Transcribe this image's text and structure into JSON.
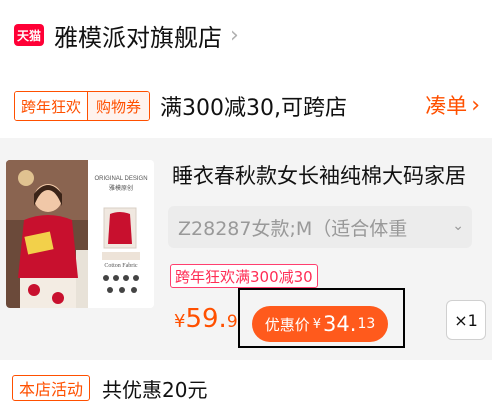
{
  "store": {
    "logo_text": "天猫",
    "name": "雅模派对旗舰店"
  },
  "promo": {
    "tag_left": "跨年狂欢",
    "tag_right": "购物券",
    "text": "满300减30,可跨店",
    "action_label": "凑单"
  },
  "item": {
    "title": "睡衣春秋款女长袖纯棉大码家居",
    "sku": "Z28287女款;M（适合体重",
    "event_tag": "跨年狂欢满300减30",
    "price_symbol": "¥",
    "price_integer": "59.",
    "price_decimal": "9",
    "discount_label": "优惠价",
    "discount_symbol": "¥",
    "discount_integer": "34.",
    "discount_decimal": "13",
    "quantity": "×1",
    "thumb_text_top": "ORIGINAL DESIGN",
    "thumb_text_sub": "雅模原创",
    "thumb_text_bottom": "Cotton Fabric"
  },
  "shop_activity": {
    "tag": "本店活动",
    "text": "共优惠20元"
  },
  "colors": {
    "accent": "#ff5000",
    "tmall_red": "#ff0036",
    "event_pink": "#ff2d55",
    "card_bg": "#f4f4f4"
  }
}
